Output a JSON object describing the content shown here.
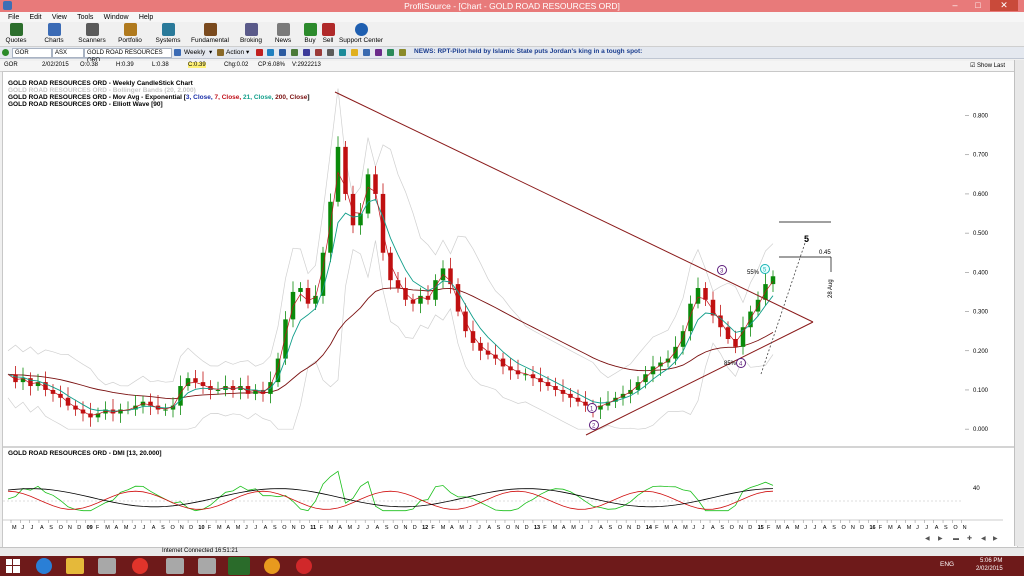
{
  "window": {
    "title": "ProfitSource - [Chart - GOLD ROAD RESOURCES ORD]",
    "controls": [
      "–",
      "□",
      "✕"
    ]
  },
  "menu": [
    "File",
    "Edit",
    "View",
    "Tools",
    "Window",
    "Help"
  ],
  "toolbar": [
    {
      "label": "Quotes",
      "color": "#2c6e2c"
    },
    {
      "label": "Charts",
      "color": "#3b6bb5"
    },
    {
      "label": "Scanners",
      "color": "#5a5a5a"
    },
    {
      "label": "Portfolio",
      "color": "#b07a1e"
    },
    {
      "label": "Systems",
      "color": "#2a7a9a"
    },
    {
      "label": "Fundamental",
      "color": "#7a4a1e"
    },
    {
      "label": "Broking",
      "color": "#5a5a8a"
    },
    {
      "label": "News",
      "color": "#7a7a7a"
    },
    {
      "label": "Buy",
      "color": "#2c8a2c"
    },
    {
      "label": "Sell",
      "color": "#b02a2a"
    },
    {
      "label": "Support Center",
      "color": "#1f5fb0"
    }
  ],
  "quotebar": {
    "code": "GOR",
    "exchange": "ASX",
    "security": "GOLD ROAD RESOURCES ORD",
    "period": "Weekly",
    "action": "Action"
  },
  "news": "NEWS: RPT-Pilot held by Islamic State puts Jordan's king in a tough spot:",
  "stats": {
    "code": "GOR",
    "date": "2/02/2015",
    "open": "O:0.38",
    "high": "H:0.39",
    "low": "L:0.38",
    "close": "C:0.39",
    "chg": "Chg:0.02",
    "cp": "CP:6.08%",
    "volume": "V:2922213",
    "show_last": "Show Last"
  },
  "legend": {
    "line1": "GOLD ROAD RESOURCES ORD - Weekly CandleStick Chart",
    "line2": "GOLD ROAD RESOURCES ORD - Bollinger Bands (20, 2.000)",
    "line3_prefix": "GOLD ROAD RESOURCES ORD - Mov Avg - Exponential [",
    "line3_parts": [
      {
        "text": "3, Close, ",
        "color": "#1a2fa8"
      },
      {
        "text": "7, Close, ",
        "color": "#c0101a"
      },
      {
        "text": "21, Close, ",
        "color": "#109e8a"
      },
      {
        "text": "200, Close",
        "color": "#7a1010"
      }
    ],
    "line3_suffix": "]",
    "line4": "GOLD ROAD RESOURCES ORD - Elliott Wave [90]"
  },
  "dmi_title": "GOLD ROAD RESOURCES ORD - DMI [13, 20.000]",
  "chart_data": {
    "type": "candlestick",
    "price_axis": {
      "ticks": [
        "0.000",
        "0.100",
        "0.200",
        "0.300",
        "0.400",
        "0.500",
        "0.600",
        "0.700",
        "0.800"
      ],
      "ylim": [
        -0.02,
        0.86
      ]
    },
    "close_series": [
      0.14,
      0.12,
      0.13,
      0.11,
      0.12,
      0.1,
      0.09,
      0.08,
      0.06,
      0.05,
      0.04,
      0.03,
      0.04,
      0.05,
      0.04,
      0.05,
      0.05,
      0.06,
      0.07,
      0.06,
      0.05,
      0.05,
      0.06,
      0.11,
      0.13,
      0.12,
      0.11,
      0.1,
      0.1,
      0.11,
      0.1,
      0.11,
      0.09,
      0.1,
      0.09,
      0.12,
      0.18,
      0.28,
      0.35,
      0.36,
      0.32,
      0.34,
      0.45,
      0.58,
      0.72,
      0.6,
      0.52,
      0.55,
      0.65,
      0.6,
      0.45,
      0.38,
      0.36,
      0.33,
      0.32,
      0.34,
      0.33,
      0.38,
      0.41,
      0.37,
      0.3,
      0.25,
      0.22,
      0.2,
      0.19,
      0.18,
      0.16,
      0.15,
      0.14,
      0.14,
      0.13,
      0.12,
      0.11,
      0.1,
      0.09,
      0.08,
      0.07,
      0.06,
      0.05,
      0.06,
      0.07,
      0.08,
      0.09,
      0.1,
      0.12,
      0.14,
      0.16,
      0.17,
      0.18,
      0.21,
      0.25,
      0.32,
      0.36,
      0.33,
      0.29,
      0.26,
      0.23,
      0.21,
      0.26,
      0.3,
      0.33,
      0.37,
      0.39
    ],
    "overlay_labels": [
      {
        "text": "55%",
        "color": "#000"
      },
      {
        "text": "85%",
        "color": "#000"
      },
      {
        "text": "0.45",
        "color": "#000"
      },
      {
        "text": "28 Aug",
        "color": "#000"
      },
      {
        "text": "5",
        "color": "#000"
      }
    ],
    "wave_labels": [
      "1",
      "2",
      "3",
      "4",
      "5"
    ],
    "dmi": {
      "level_label": "40"
    },
    "x_tick_labels": [
      "M",
      "J",
      "J",
      "A",
      "S",
      "O",
      "N",
      "D",
      "09",
      "F",
      "M",
      "A",
      "M",
      "J",
      "J",
      "A",
      "S",
      "O",
      "N",
      "D",
      "10",
      "F",
      "M",
      "A",
      "M",
      "J",
      "J",
      "A",
      "S",
      "O",
      "N",
      "D",
      "11",
      "F",
      "M",
      "A",
      "M",
      "J",
      "J",
      "A",
      "S",
      "O",
      "N",
      "D",
      "12",
      "F",
      "M",
      "A",
      "M",
      "J",
      "J",
      "A",
      "S",
      "O",
      "N",
      "D",
      "13",
      "F",
      "M",
      "A",
      "M",
      "J",
      "J",
      "A",
      "S",
      "O",
      "N",
      "D",
      "14",
      "F",
      "M",
      "A",
      "M",
      "J",
      "J",
      "A",
      "S",
      "O",
      "N",
      "D",
      "15",
      "F",
      "M",
      "A",
      "M",
      "J",
      "J",
      "A",
      "S",
      "O",
      "N",
      "D",
      "16",
      "F",
      "M",
      "A",
      "M",
      "J",
      "J",
      "A",
      "S",
      "O",
      "N"
    ],
    "colors": {
      "up": "#0a8a0a",
      "down": "#c01010",
      "trend": "#8a1a1a",
      "ema3": "#1a2fa8",
      "ema7": "#c0101a",
      "ema21": "#109e8a",
      "ema200": "#7a1010",
      "dmi_plus": "#1abf1a",
      "dmi_minus": "#d01010",
      "adx": "#000000"
    }
  },
  "statusbar": {
    "connection": "Internet Connected 16:51:21"
  },
  "taskbar": {
    "time": "5:06 PM",
    "date": "2/02/2015",
    "lang": "ENG",
    "icons": [
      {
        "name": "windows",
        "color": "#ffffff"
      },
      {
        "name": "ie",
        "color": "#2a7fd6"
      },
      {
        "name": "explorer",
        "color": "#e5b93a"
      },
      {
        "name": "files",
        "color": "#a8a8a8"
      },
      {
        "name": "chrome",
        "color": "#e0342b"
      },
      {
        "name": "printer",
        "color": "#a8a8a8"
      },
      {
        "name": "app-go",
        "color": "#2a6b2a"
      },
      {
        "name": "app-orange",
        "color": "#e89a1e"
      },
      {
        "name": "app-red",
        "color": "#d0282a"
      }
    ]
  }
}
